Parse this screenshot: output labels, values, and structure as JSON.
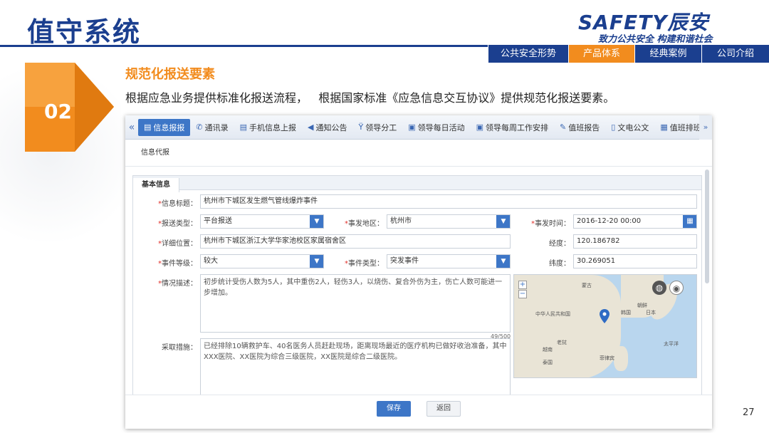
{
  "slide": {
    "title": "值守系统",
    "page_number": "27",
    "accent_color": "#f28c1e",
    "brand_color": "#1b3f8f"
  },
  "logo": {
    "main": "SAFETY辰安",
    "slogan": "致力公共安全 构建和谐社会"
  },
  "nav": {
    "tabs": [
      {
        "label": "公共安全形势",
        "active": false
      },
      {
        "label": "产品体系",
        "active": true
      },
      {
        "label": "经典案例",
        "active": false
      },
      {
        "label": "公司介绍",
        "active": false
      }
    ]
  },
  "section": {
    "number": "02",
    "title": "规范化报送要素",
    "description": "根据应急业务提供标准化报送流程，   根据国家标准《应急信息交互协议》提供规范化报送要素。"
  },
  "app": {
    "toolbar": [
      {
        "label": "信息报报",
        "icon": "message-icon",
        "active": true
      },
      {
        "label": "通讯录",
        "icon": "phone-icon",
        "active": false
      },
      {
        "label": "手机信息上报",
        "icon": "mobile-message-icon",
        "active": false
      },
      {
        "label": "通知公告",
        "icon": "announcement-icon",
        "active": false
      },
      {
        "label": "领导分工",
        "icon": "org-icon",
        "active": false
      },
      {
        "label": "领导每日活动",
        "icon": "calendar-icon",
        "active": false
      },
      {
        "label": "领导每周工作安排",
        "icon": "calendar-week-icon",
        "active": false
      },
      {
        "label": "值班报告",
        "icon": "edit-icon",
        "active": false
      },
      {
        "label": "文电公文",
        "icon": "document-icon",
        "active": false
      },
      {
        "label": "值班排班",
        "icon": "schedule-icon",
        "active": false
      }
    ],
    "breadcrumb": "信息代报",
    "card_title": "基本信息",
    "form": {
      "info_title": {
        "label": "信息标题：",
        "value": "杭州市下城区发生燃气管线爆炸事件"
      },
      "report_type": {
        "label": "报送类型：",
        "value": "平台报送"
      },
      "event_region": {
        "label": "事发地区：",
        "value": "杭州市"
      },
      "event_time": {
        "label": "事发时间：",
        "value": "2016-12-20 00:00"
      },
      "address": {
        "label": "详细位置：",
        "value": "杭州市下城区浙江大学华家池校区家属宿舍区"
      },
      "longitude": {
        "label": "经度：",
        "value": "120.186782"
      },
      "event_level": {
        "label": "事件等级：",
        "value": "较大"
      },
      "event_type": {
        "label": "事件类型：",
        "value": "突发事件"
      },
      "latitude": {
        "label": "纬度：",
        "value": "30.269051"
      },
      "situation": {
        "label": "情况描述：",
        "value": "初步统计受伤人数为5人，其中重伤2人，轻伤3人，以烧伤、复合外伤为主，伤亡人数可能进一步增加。",
        "counter": "49/500"
      },
      "measures": {
        "label": "采取措施：",
        "value": "已经排除10辆救护车、40名医务人员赶赴现场，距离现场最近的医疗机构已做好收治准备，其中XXX医院、XX医院为综合三级医院，XX医院是综合二级医院。"
      }
    },
    "map": {
      "labels": [
        "蒙古",
        "中华人民共和国",
        "朝鲜",
        "韩国",
        "日本",
        "越南",
        "老挝",
        "泰国",
        "菲律宾",
        "太平洋"
      ]
    },
    "buttons": {
      "save": "保存",
      "back": "返回"
    }
  }
}
